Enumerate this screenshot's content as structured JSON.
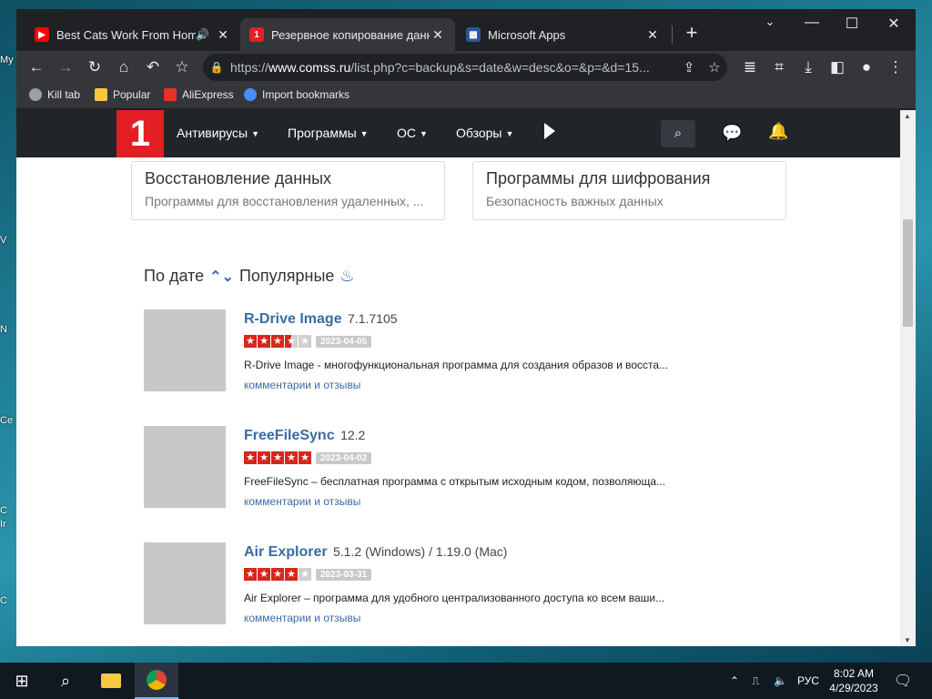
{
  "browser": {
    "tabs": [
      {
        "title": "Best Cats Work From Home",
        "favicon": "youtube-icon",
        "audio": true
      },
      {
        "title": "Резервное копирование данн",
        "favicon": "comss-icon",
        "active": true
      },
      {
        "title": "Microsoft Apps",
        "favicon": "microsoft-apps-icon"
      }
    ],
    "url_prefix": "https://",
    "url_host": "www.comss.ru",
    "url_path": "/list.php?c=backup&s=date&w=desc&o=&p=&d=15...",
    "bookmarks": [
      {
        "label": "Kill tab",
        "icon": "globe-icon"
      },
      {
        "label": "Popular",
        "icon": "folder-icon"
      },
      {
        "label": "AliExpress",
        "icon": "aliexpress-icon"
      },
      {
        "label": "Import bookmarks",
        "icon": "gear-icon"
      }
    ]
  },
  "site": {
    "logo_text": "1",
    "nav": [
      "Антивирусы",
      "Программы",
      "ОС",
      "Обзоры"
    ],
    "cards": [
      {
        "title": "Восстановление данных",
        "subtitle": "Программы для восстановления удаленных, ..."
      },
      {
        "title": "Программы для шифрования",
        "subtitle": "Безопасность важных данных"
      }
    ],
    "sort": {
      "by_date": "По дате",
      "popular": "Популярные"
    },
    "items": [
      {
        "name": "R-Drive Image",
        "version": "7.1.7105",
        "rating": 3.5,
        "date": "2023-04-05",
        "desc": "R-Drive Image - многофункциональная программа для создания образов и восста...",
        "reviews": "комментарии и отзывы"
      },
      {
        "name": "FreeFileSync",
        "version": "12.2",
        "rating": 5,
        "date": "2023-04-02",
        "desc": "FreeFileSync – бесплатная программа с открытым исходным кодом, позволяюща...",
        "reviews": "комментарии и отзывы"
      },
      {
        "name": "Air Explorer",
        "version": "5.1.2 (Windows) / 1.19.0 (Mac)",
        "rating": 4,
        "date": "2023-03-31",
        "desc": "Air Explorer – программа для удобного централизованного доступа ко всем ваши...",
        "reviews": "комментарии и отзывы"
      }
    ]
  },
  "taskbar": {
    "lang": "РУС",
    "time": "8:02 AM",
    "date": "4/29/2023"
  },
  "desktop_fragments": [
    "My",
    "V",
    "N",
    "Ce",
    "C",
    "Ir",
    "C"
  ]
}
